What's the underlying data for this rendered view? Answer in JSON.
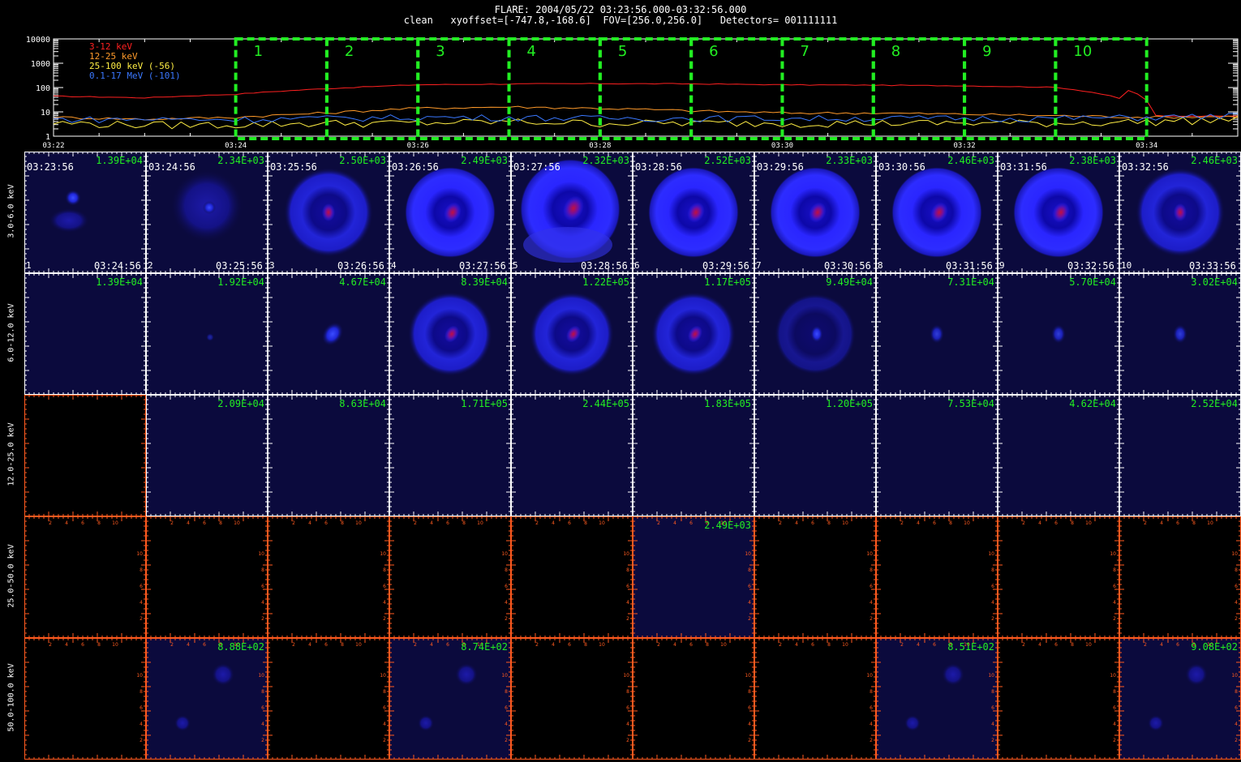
{
  "header": {
    "line1": "FLARE: 2004/05/22 03:23:56.000-03:32:56.000",
    "line2": "clean   xyoffset=[-747.8,-168.6]  FOV=[256.0,256.0]   Detectors= 001111111"
  },
  "lightcurve": {
    "legend": [
      {
        "label": "3-12 keV",
        "color": "#ff2020"
      },
      {
        "label": "12-25 keV",
        "color": "#ff9a2a"
      },
      {
        "label": "25-100 keV (-56)",
        "color": "#ffee44"
      },
      {
        "label": "0.1-17 MeV (-101)",
        "color": "#3a78ff"
      }
    ],
    "y_ticks": [
      "10000",
      "1000",
      "100",
      "10",
      "1"
    ],
    "x_ticks": [
      "03:22",
      "03:24",
      "03:26",
      "03:28",
      "03:30",
      "03:32",
      "03:34"
    ],
    "x_range_min": [
      0,
      13
    ],
    "interval_labels": [
      "1",
      "2",
      "3",
      "4",
      "5",
      "6",
      "7",
      "8",
      "9",
      "10"
    ],
    "intervals_min": [
      [
        2,
        3
      ],
      [
        3,
        4
      ],
      [
        4,
        5
      ],
      [
        5,
        6
      ],
      [
        6,
        7
      ],
      [
        7,
        8
      ],
      [
        8,
        9
      ],
      [
        9,
        10
      ],
      [
        10,
        11
      ],
      [
        11,
        12
      ]
    ],
    "highlight_color": "#22ee22",
    "band_levels": {
      "3-12": [
        44,
        38,
        53,
        90,
        130,
        140,
        145,
        142,
        130,
        125,
        118,
        102,
        6.5,
        7
      ],
      "12-25": [
        6,
        5,
        6,
        9,
        14,
        16,
        14,
        11,
        9,
        9,
        8,
        7,
        6,
        6.5
      ],
      "25-100": [
        3.5,
        3,
        3,
        3.5,
        3.5,
        4,
        3.5,
        3.5,
        3.5,
        3.5,
        3.5,
        3.5,
        4,
        5
      ],
      "0.1-17": [
        5,
        5,
        5,
        5.5,
        6,
        6,
        5.5,
        5.5,
        5.5,
        5.5,
        5.5,
        5.5,
        6,
        7
      ]
    }
  },
  "rows": [
    {
      "label": "3.0-6.0 keV"
    },
    {
      "label": "6.0-12.0 keV"
    },
    {
      "label": "12.0-25.0 keV"
    },
    {
      "label": "25.0-50.0 keV"
    },
    {
      "label": "50.0-100.0 keV"
    }
  ],
  "columns": {
    "start_times": [
      "03:23:56",
      "03:24:56",
      "03:25:56",
      "03:26:56",
      "03:27:56",
      "03:28:56",
      "03:29:56",
      "03:30:56",
      "03:31:56",
      "03:32:56"
    ],
    "end_times": [
      "03:24:56",
      "03:25:56",
      "03:26:56",
      "03:27:56",
      "03:28:56",
      "03:29:56",
      "03:30:56",
      "03:31:56",
      "03:32:56",
      "03:33:56"
    ],
    "numbers": [
      "1",
      "2",
      "3",
      "4",
      "5",
      "6",
      "7",
      "8",
      "9",
      "10"
    ]
  },
  "panel_values": [
    [
      "1.39E+04",
      "2.34E+03",
      "2.50E+03",
      "2.49E+03",
      "2.32E+03",
      "2.52E+03",
      "2.33E+03",
      "2.46E+03",
      "2.38E+03",
      "2.46E+03"
    ],
    [
      "1.39E+04",
      "1.92E+04",
      "4.67E+04",
      "8.39E+04",
      "1.22E+05",
      "1.17E+05",
      "9.49E+04",
      "7.31E+04",
      "5.70E+04",
      "3.02E+04"
    ],
    [
      "",
      "2.09E+04",
      "8.63E+04",
      "1.71E+05",
      "2.44E+05",
      "1.83E+05",
      "1.20E+05",
      "7.53E+04",
      "4.62E+04",
      "2.52E+04"
    ],
    [
      "",
      "",
      "",
      "",
      "",
      "2.49E+03",
      "",
      "",
      "",
      ""
    ],
    [
      "",
      "8.88E+02",
      "",
      "8.74E+02",
      "",
      "",
      "",
      "8.51E+02",
      "",
      "9.08E+02"
    ]
  ],
  "panel_images": [
    [
      "faint",
      "blob",
      "ring_dim",
      "ring",
      "ring_big",
      "ring",
      "ring",
      "ring",
      "ring",
      "ring_dim"
    ],
    [
      "empty",
      "faint_dot",
      "dot",
      "ring_mid",
      "ring_mid",
      "ring_mid",
      "ring_faint",
      "dot_faint",
      "dot_faint",
      "dot_faint"
    ],
    [
      "black",
      "empty",
      "empty",
      "empty",
      "empty",
      "empty",
      "empty",
      "empty",
      "empty",
      "empty"
    ],
    [
      "black",
      "black",
      "black",
      "black",
      "black",
      "empty",
      "black",
      "black",
      "black",
      "black"
    ],
    [
      "black",
      "noise",
      "black",
      "noise",
      "black",
      "black",
      "black",
      "noise",
      "black",
      "noise"
    ]
  ],
  "axis_tick_labels": [
    "2",
    "4",
    "6",
    "8",
    "10"
  ],
  "colors": {
    "panel_bg": "#0b0a3d",
    "axis_white": "#ffffff",
    "axis_orange": "#ff5a1f",
    "value_green": "#22ee22"
  }
}
